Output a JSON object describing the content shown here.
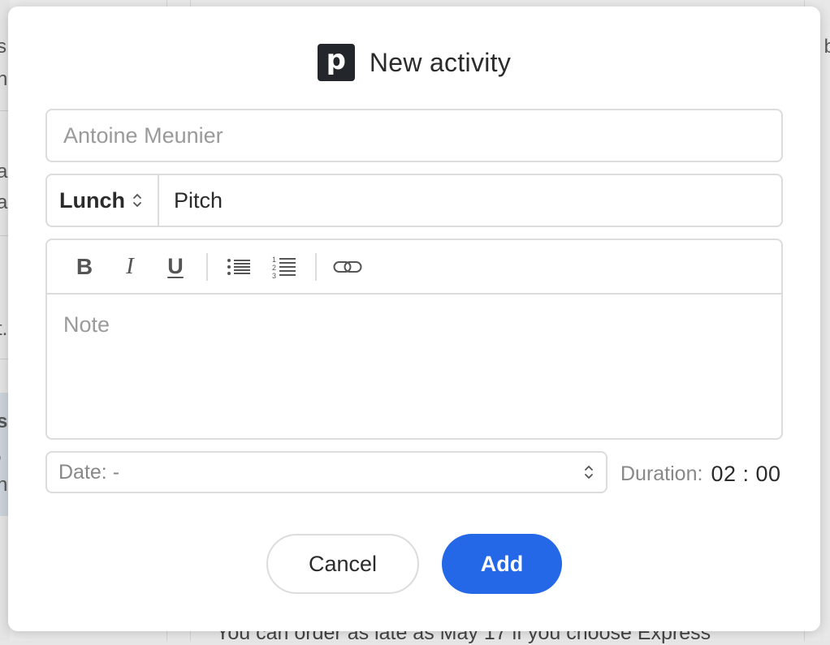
{
  "background": {
    "bottom_text": "You can order as late as May 17 if you choose Express",
    "left_letters": [
      "s",
      "n",
      "a",
      "a",
      "t.",
      "s",
      ",",
      "n"
    ],
    "right_letter": "b"
  },
  "modal": {
    "logo_letter": "p",
    "title": "New activity",
    "contact": {
      "placeholder": "Antoine Meunier",
      "value": ""
    },
    "activity_type": {
      "selected": "Lunch"
    },
    "subject": {
      "value": "Pitch"
    },
    "toolbar": {
      "bold": "B",
      "italic": "I",
      "underline": "U"
    },
    "note": {
      "placeholder": "Note",
      "value": ""
    },
    "date": {
      "label": "Date: -"
    },
    "duration": {
      "label": "Duration:",
      "value": "02 : 00"
    },
    "buttons": {
      "cancel": "Cancel",
      "add": "Add"
    },
    "colors": {
      "primary": "#2468e8",
      "border": "#dcdcdc",
      "logo_bg": "#23272b"
    }
  }
}
